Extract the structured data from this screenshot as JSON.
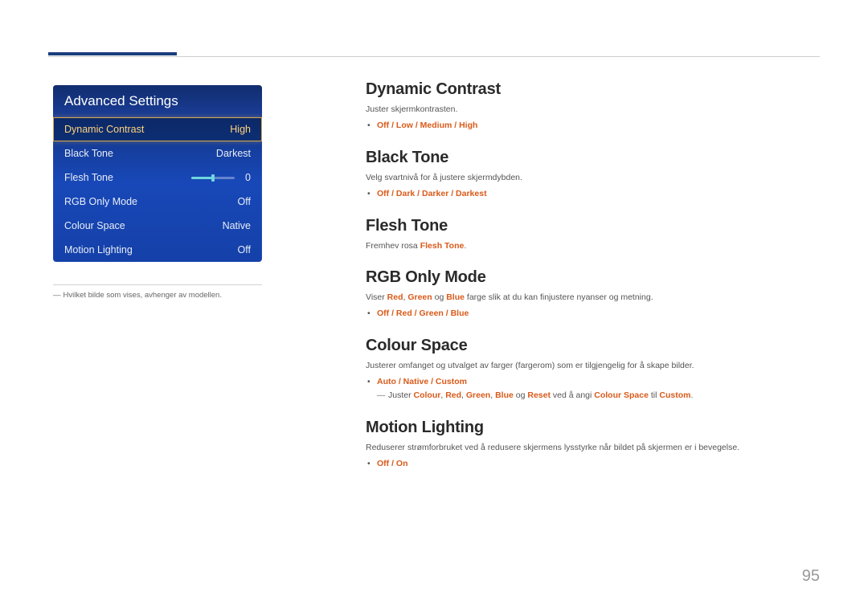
{
  "page_number": "95",
  "menu": {
    "title": "Advanced Settings",
    "rows": [
      {
        "label": "Dynamic Contrast",
        "value": "High",
        "selected": true,
        "type": "text"
      },
      {
        "label": "Black Tone",
        "value": "Darkest",
        "selected": false,
        "type": "text"
      },
      {
        "label": "Flesh Tone",
        "value": "0",
        "selected": false,
        "type": "slider"
      },
      {
        "label": "RGB Only Mode",
        "value": "Off",
        "selected": false,
        "type": "text"
      },
      {
        "label": "Colour Space",
        "value": "Native",
        "selected": false,
        "type": "text"
      },
      {
        "label": "Motion Lighting",
        "value": "Off",
        "selected": false,
        "type": "text"
      }
    ]
  },
  "footnote": {
    "dash": "―",
    "text": "Hvilket bilde som vises, avhenger av modellen."
  },
  "sections": {
    "dynamic_contrast": {
      "title": "Dynamic Contrast",
      "desc": "Juster skjermkontrasten.",
      "options": "Off / Low / Medium / High"
    },
    "black_tone": {
      "title": "Black Tone",
      "desc": "Velg svartnivå for å justere skjermdybden.",
      "options": "Off / Dark / Darker / Darkest"
    },
    "flesh_tone": {
      "title": "Flesh Tone",
      "desc_pre": "Fremhev rosa ",
      "desc_em": "Flesh Tone",
      "desc_post": "."
    },
    "rgb_only": {
      "title": "RGB Only Mode",
      "desc_pre": "Viser ",
      "red": "Red",
      "comma1": ", ",
      "green": "Green",
      "and": " og ",
      "blue": "Blue",
      "desc_post": " farge slik at du kan finjustere nyanser og metning.",
      "options": "Off / Red / Green / Blue"
    },
    "colour_space": {
      "title": "Colour Space",
      "desc": "Justerer omfanget og utvalget av farger (fargerom) som er tilgjengelig for å skape bilder.",
      "options": "Auto / Native / Custom",
      "sub_dash": "―",
      "sub_pre": "Juster ",
      "sub_colour": "Colour",
      "sub_c1": ", ",
      "sub_red": "Red",
      "sub_c2": ", ",
      "sub_green": "Green",
      "sub_c3": ", ",
      "sub_blue": "Blue",
      "sub_og": " og ",
      "sub_reset": "Reset",
      "sub_mid": " ved å angi ",
      "sub_cs": "Colour Space",
      "sub_til": " til ",
      "sub_custom": "Custom",
      "sub_end": "."
    },
    "motion_lighting": {
      "title": "Motion Lighting",
      "desc": "Reduserer strømforbruket ved å redusere skjermens lysstyrke når bildet på skjermen er i bevegelse.",
      "options": "Off / On"
    }
  }
}
